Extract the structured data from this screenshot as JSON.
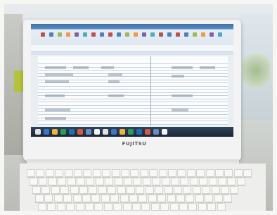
{
  "scene": {
    "description_label": "",
    "brand_text": "FUJITSU"
  },
  "colors": {
    "ribbon": "#3b6fa7",
    "sheet": "#fbfcfd",
    "taskbar": "#1a2638",
    "laptop_body": "#f3f3f3"
  }
}
